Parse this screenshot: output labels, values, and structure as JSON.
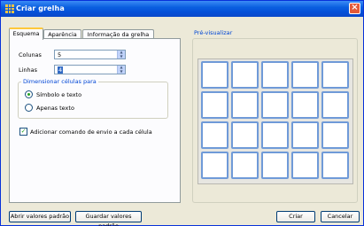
{
  "window": {
    "title": "Criar grelha"
  },
  "tabs": [
    {
      "label": "Esquema"
    },
    {
      "label": "Aparência"
    },
    {
      "label": "Informação da grelha"
    }
  ],
  "layout": {
    "columns_label": "Colunas",
    "columns_value": "5",
    "rows_label": "Linhas",
    "rows_value": "4",
    "group_title": "Dimensionar células para",
    "radio_symbol_text": "Símbolo e texto",
    "radio_text_only": "Apenas texto",
    "selected_radio": "Símbolo e texto",
    "checkbox_label": "Adicionar comando de envio a cada célula",
    "checkbox_checked": true
  },
  "preview": {
    "title": "Pré-visualizar",
    "columns": 5,
    "rows": 4
  },
  "buttons": {
    "open_defaults": "Abrir valores padrão",
    "save_defaults": "Guardar valores padrão",
    "create": "Criar",
    "cancel": "Cancelar"
  }
}
